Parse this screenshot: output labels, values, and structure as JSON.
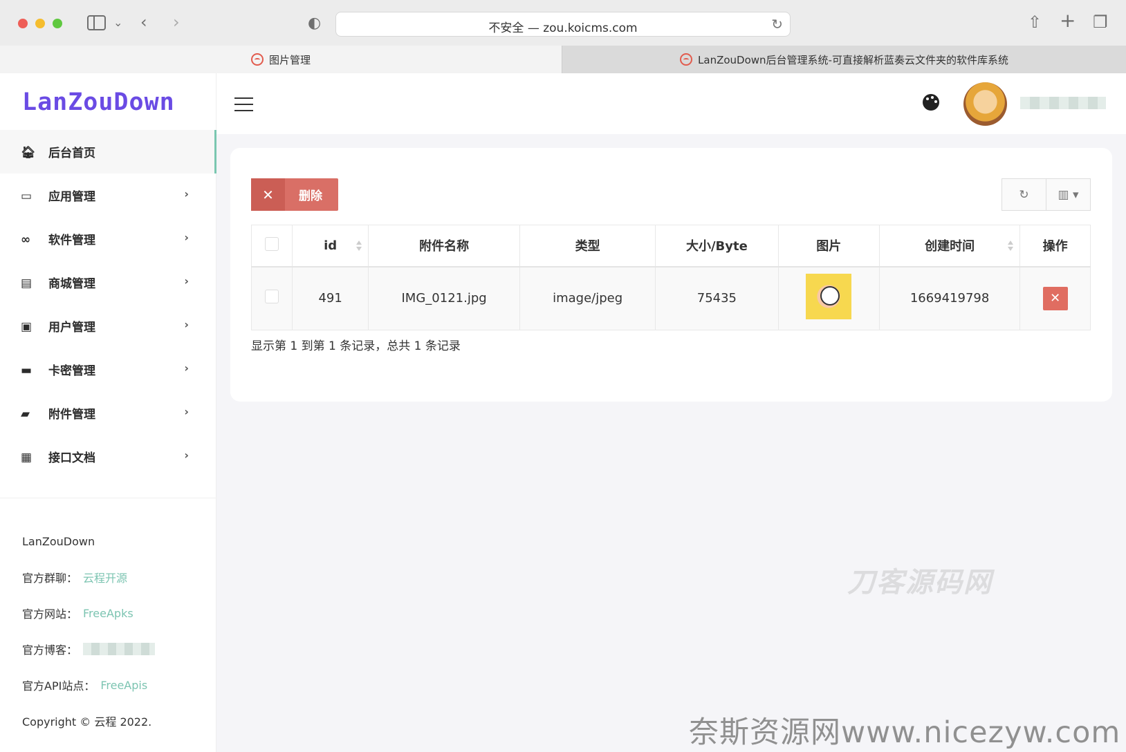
{
  "browser": {
    "address": "不安全 — zou.koicms.com",
    "tabs": [
      {
        "label": "图片管理"
      },
      {
        "label": "LanZouDown后台管理系统-可直接解析蓝奏云文件夹的软件库系统"
      }
    ]
  },
  "app": {
    "logo": "LanZouDown",
    "menu": [
      {
        "label": "后台首页",
        "icon": "home-icon"
      },
      {
        "label": "应用管理",
        "icon": "laptop-icon"
      },
      {
        "label": "软件管理",
        "icon": "infinity-icon"
      },
      {
        "label": "商城管理",
        "icon": "store-icon"
      },
      {
        "label": "用户管理",
        "icon": "user-card-icon"
      },
      {
        "label": "卡密管理",
        "icon": "credit-card-icon"
      },
      {
        "label": "附件管理",
        "icon": "folder-icon"
      },
      {
        "label": "接口文档",
        "icon": "inbox-icon"
      }
    ],
    "footer": {
      "name": "LanZouDown",
      "group_label": "官方群聊：",
      "group_link": "云程开源",
      "site_label": "官方网站：",
      "site_link": "FreeApks",
      "blog_label": "官方博客：",
      "api_label": "官方API站点：",
      "api_link": "FreeApis",
      "copyright": "Copyright © 云程 2022."
    }
  },
  "toolbar": {
    "delete_label": "删除"
  },
  "table": {
    "headers": [
      "id",
      "附件名称",
      "类型",
      "大小/Byte",
      "图片",
      "创建时间",
      "操作"
    ],
    "rows": [
      {
        "id": "491",
        "name": "IMG_0121.jpg",
        "type": "image/jpeg",
        "size": "75435",
        "created": "1669419798"
      }
    ],
    "summary": "显示第 1 到第 1 条记录，总共 1 条记录"
  },
  "watermarks": {
    "upper": "刀客源码网",
    "lower": "奈斯资源网www.nicezyw.com"
  },
  "colors": {
    "accent": "#7ac7b0",
    "danger": "#d96f66",
    "logo": "#6a4be4"
  }
}
